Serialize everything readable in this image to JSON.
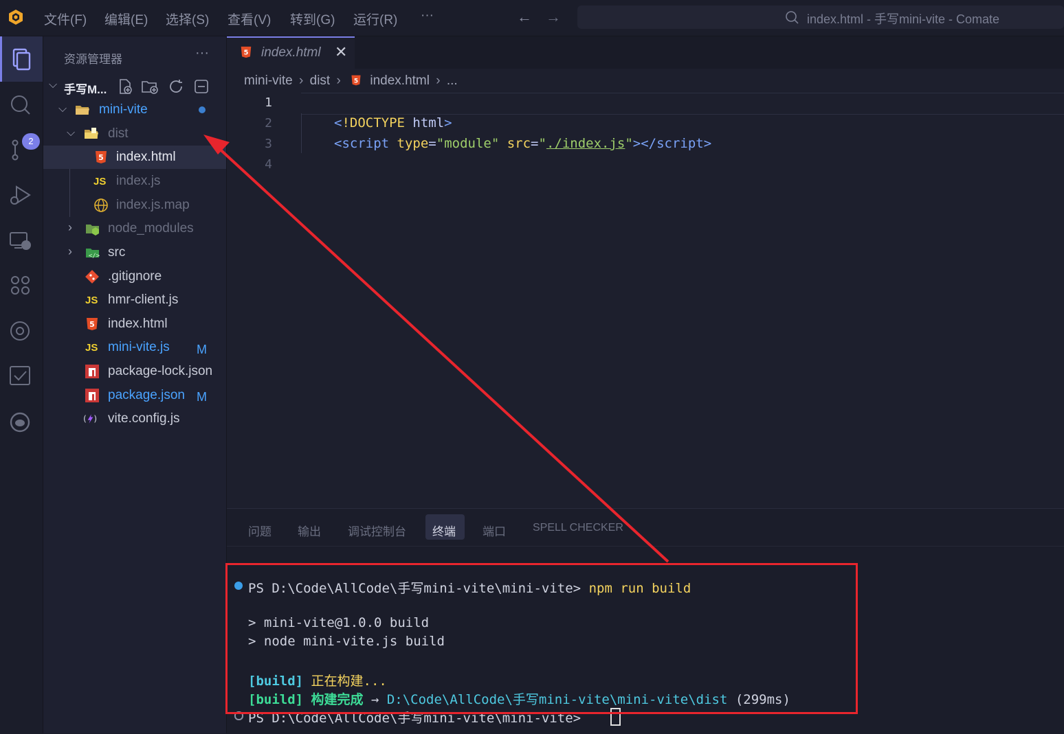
{
  "titlebar": {
    "menus": [
      "文件(F)",
      "编辑(E)",
      "选择(S)",
      "查看(V)",
      "转到(G)",
      "运行(R)",
      "···"
    ],
    "command_center": "index.html - 手写mini-vite - Comate"
  },
  "activity_bar": {
    "items": [
      "explorer-icon",
      "search-icon",
      "source-control-icon",
      "run-debug-icon",
      "remote-explorer-icon",
      "extensions-icon",
      "browser-icon",
      "tasks-icon",
      "comate-icon"
    ],
    "scm_badge": "2"
  },
  "sidebar": {
    "title": "资源管理器",
    "more": "···",
    "root": "手写M...",
    "tree": [
      {
        "label": "mini-vite",
        "type": "folder-open",
        "color": "#4aa3ff",
        "modified_dot": true
      },
      {
        "label": "dist",
        "type": "folder-open",
        "color": "#6a6e80"
      },
      {
        "label": "index.html",
        "type": "html",
        "color": "#e6e8f0"
      },
      {
        "label": "index.js",
        "type": "js",
        "color": "#6a6e80"
      },
      {
        "label": "index.js.map",
        "type": "map",
        "color": "#6a6e80"
      },
      {
        "label": "node_modules",
        "type": "folder-node",
        "color": "#6a6e80"
      },
      {
        "label": "src",
        "type": "folder-src",
        "color": "#c9ccd8"
      },
      {
        "label": ".gitignore",
        "type": "git",
        "color": "#c9ccd8"
      },
      {
        "label": "hmr-client.js",
        "type": "js",
        "color": "#c9ccd8"
      },
      {
        "label": "index.html",
        "type": "html",
        "color": "#c9ccd8"
      },
      {
        "label": "mini-vite.js",
        "type": "js",
        "color": "#4aa3ff",
        "badge": "M"
      },
      {
        "label": "package-lock.json",
        "type": "npm",
        "color": "#c9ccd8"
      },
      {
        "label": "package.json",
        "type": "npm",
        "color": "#4aa3ff",
        "badge": "M"
      },
      {
        "label": "vite.config.js",
        "type": "vite",
        "color": "#c9ccd8"
      }
    ]
  },
  "editor": {
    "tab_label": "index.html",
    "tab_close": "✕",
    "breadcrumb": [
      "mini-vite",
      "dist",
      "index.html",
      "..."
    ],
    "line_numbers": [
      "1",
      "2",
      "3",
      "4"
    ]
  },
  "panel": {
    "tabs": [
      "问题",
      "输出",
      "调试控制台",
      "终端",
      "端口",
      "SPELL CHECKER"
    ],
    "active_tab": "终端",
    "terminal": {
      "prompt1": "PS D:\\Code\\AllCode\\手写mini-vite\\mini-vite> ",
      "cmd1": "npm run build",
      "out1": "> mini-vite@1.0.0 build",
      "out2": "> node mini-vite.js build",
      "build_tag": "[build]",
      "building": " 正在构建...",
      "built": " 构建完成",
      "arrow": " → ",
      "path": "D:\\Code\\AllCode\\手写mini-vite\\mini-vite\\dist",
      "time": " (299ms)",
      "prompt2": "PS D:\\Code\\AllCode\\手写mini-vite\\mini-vite> "
    }
  },
  "annotation_color": "#e8252d"
}
